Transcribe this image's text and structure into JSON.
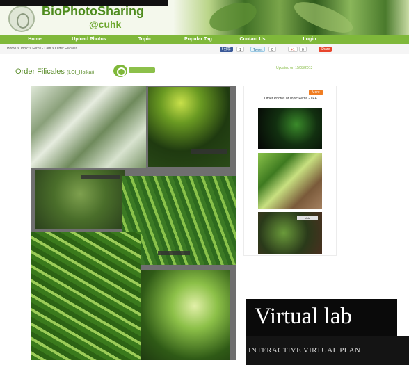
{
  "header": {
    "site_name": "BioPhotoSharing",
    "site_sub": "@cuhk"
  },
  "nav": {
    "items": [
      "Home",
      "Upload Photos",
      "Topic",
      "Popular Tag",
      "Contact Us",
      "Login"
    ]
  },
  "breadcrumb": "Home > Topic > Ferns - Lam > Order Filicales",
  "share": {
    "facebook": "f 分享",
    "facebook_count": "1",
    "tweet": "Tweet",
    "tweet_count": "0",
    "gplus": "+1",
    "gplus_count": "0",
    "more": "Share"
  },
  "page": {
    "title": "Order Filicales",
    "title_small": "(LOI_Hoikai)",
    "updated": "Updated on 15/03/2013"
  },
  "sidebar": {
    "more_label": "More",
    "title": "Other Photos of Topic Ferns - LEE",
    "thumb_label": "slide"
  },
  "watermark": {
    "title": "Virtual lab",
    "subtitle": "INTERACTIVE VIRTUAL PLAN"
  },
  "colors": {
    "accent": "#7fb83a",
    "title_green": "#5a8c2a",
    "more_orange": "#f07d22",
    "share_red": "#e8452c"
  }
}
